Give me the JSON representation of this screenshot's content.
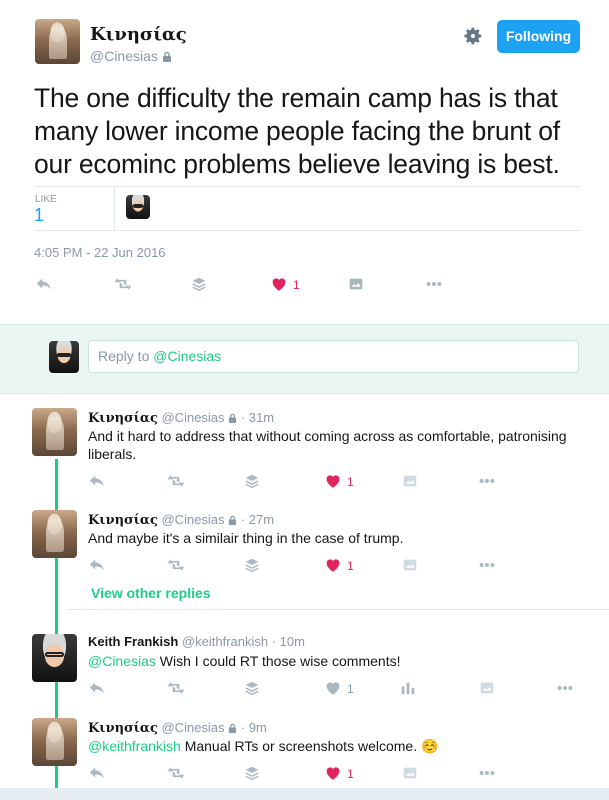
{
  "header": {
    "display_name": "Κινησίας",
    "handle": "@Cinesias",
    "following_label": "Following"
  },
  "main_tweet": {
    "text": "The one difficulty the remain camp has is that many lower income people facing the brunt of our ecominc problems believe leaving is best.",
    "like_label": "LIKE",
    "like_count": "1",
    "timestamp": "4:05 PM - 22 Jun 2016",
    "heart_count": "1"
  },
  "reply_box": {
    "prefix": "Reply to ",
    "mention": "@Cinesias"
  },
  "replies": [
    {
      "name": "Κινησίας",
      "handle": "@Cinesias",
      "time": "· 31m",
      "text": "And it hard to address that without coming across as comfortable, patronising liberals.",
      "like_count": "1"
    },
    {
      "name": "Κινησίας",
      "handle": "@Cinesias",
      "time": "· 27m",
      "text": "And maybe it's a similair thing in the case of trump.",
      "like_count": "1"
    },
    {
      "name": "Keith Frankish",
      "handle": "@keithfrankish",
      "time": "· 10m",
      "mention": "@Cinesias",
      "text": " Wish I could RT those wise comments!",
      "like_count": "1"
    },
    {
      "name": "Κινησίας",
      "handle": "@Cinesias",
      "time": "· 9m",
      "mention": "@keithfrankish",
      "text": " Manual RTs or screenshots welcome. ☺️",
      "like_count": "1"
    }
  ],
  "view_other_replies": "View other replies",
  "colors": {
    "accent_blue": "#1da1f2",
    "green": "#19cf86",
    "heart_red": "#e0245e",
    "gray": "#8899a6"
  }
}
